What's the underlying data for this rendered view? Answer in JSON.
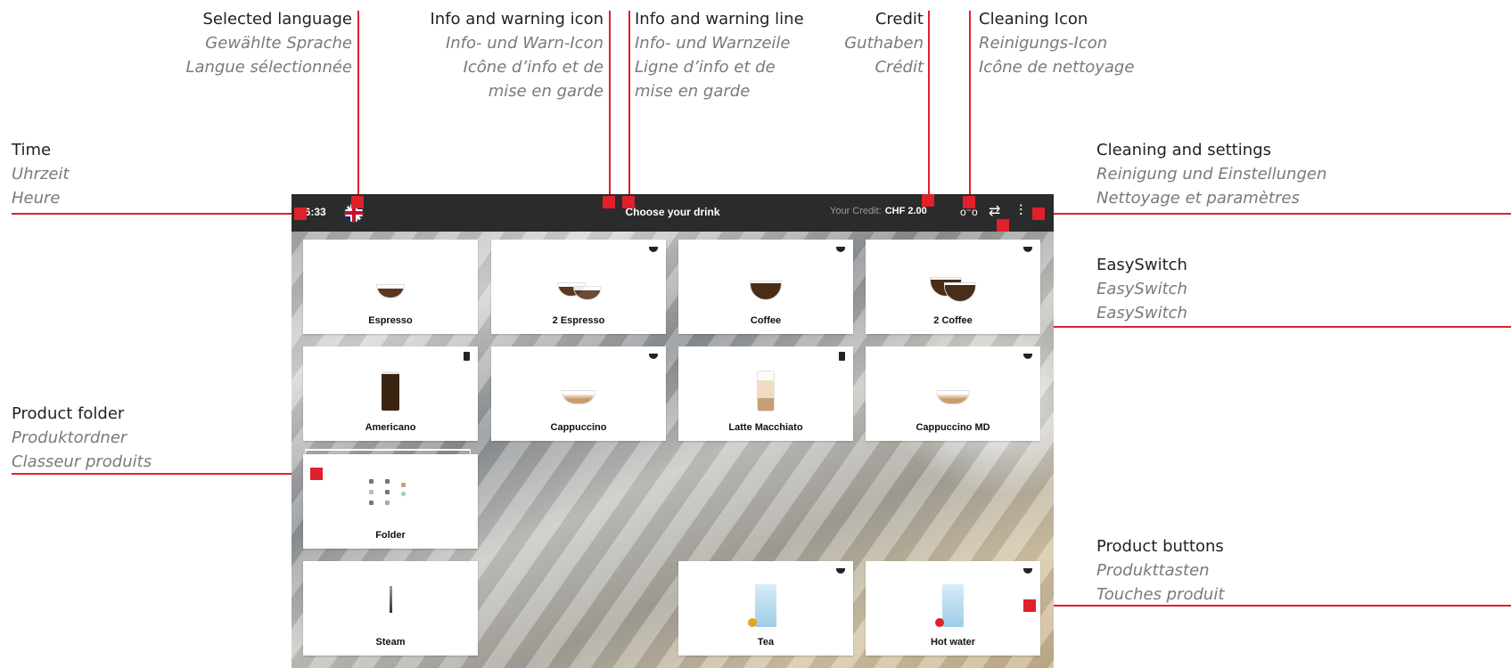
{
  "annotations": {
    "language": {
      "en": "Selected language",
      "de": "Gewählte Sprache",
      "fr": "Langue sélectionnée"
    },
    "info_icon": {
      "en": "Info and warning icon",
      "de": "Info- und Warn-Icon",
      "fr1": "Icône d’info et de",
      "fr2": "mise en garde"
    },
    "info_line": {
      "en": "Info and warning line",
      "de": "Info- und Warnzeile",
      "fr1": "Ligne d’info et de",
      "fr2": "mise en garde"
    },
    "credit": {
      "en": "Credit",
      "de": "Guthaben",
      "fr": "Crédit"
    },
    "cleaning_icon": {
      "en": "Cleaning Icon",
      "de": "Reinigungs-Icon",
      "fr": "Icône de nettoyage"
    },
    "time": {
      "en": "Time",
      "de": "Uhrzeit",
      "fr": "Heure"
    },
    "cleaning_settings": {
      "en": "Cleaning and settings",
      "de": "Reinigung und Einstellungen",
      "fr": "Nettoyage et paramètres"
    },
    "easyswitch": {
      "en": "EasySwitch",
      "de": "EasySwitch",
      "fr": "EasySwitch"
    },
    "product_folder": {
      "en": "Product folder",
      "de": "Produktordner",
      "fr": "Classeur produits"
    },
    "product_buttons": {
      "en": "Product buttons",
      "de": "Produkttasten",
      "fr": "Touches produit"
    }
  },
  "screen": {
    "time": "16:33",
    "title": "Choose your drink",
    "credit_label": "Your Credit:",
    "credit_value": "CHF 2.00",
    "icons": {
      "language": "uk-flag-icon",
      "cleaning": "cleaning-icon",
      "easyswitch": "easyswitch-icon",
      "settings": "settings-sliders-icon"
    },
    "products": [
      "Espresso",
      "2 Espresso",
      "Coffee",
      "2 Coffee",
      "Americano",
      "Cappuccino",
      "Latte Macchiato",
      "Cappuccino MD",
      "Folder",
      "Steam",
      "Tea",
      "Hot water"
    ]
  },
  "colors": {
    "accent": "#e0202a",
    "topbar": "#2b2b2b"
  }
}
